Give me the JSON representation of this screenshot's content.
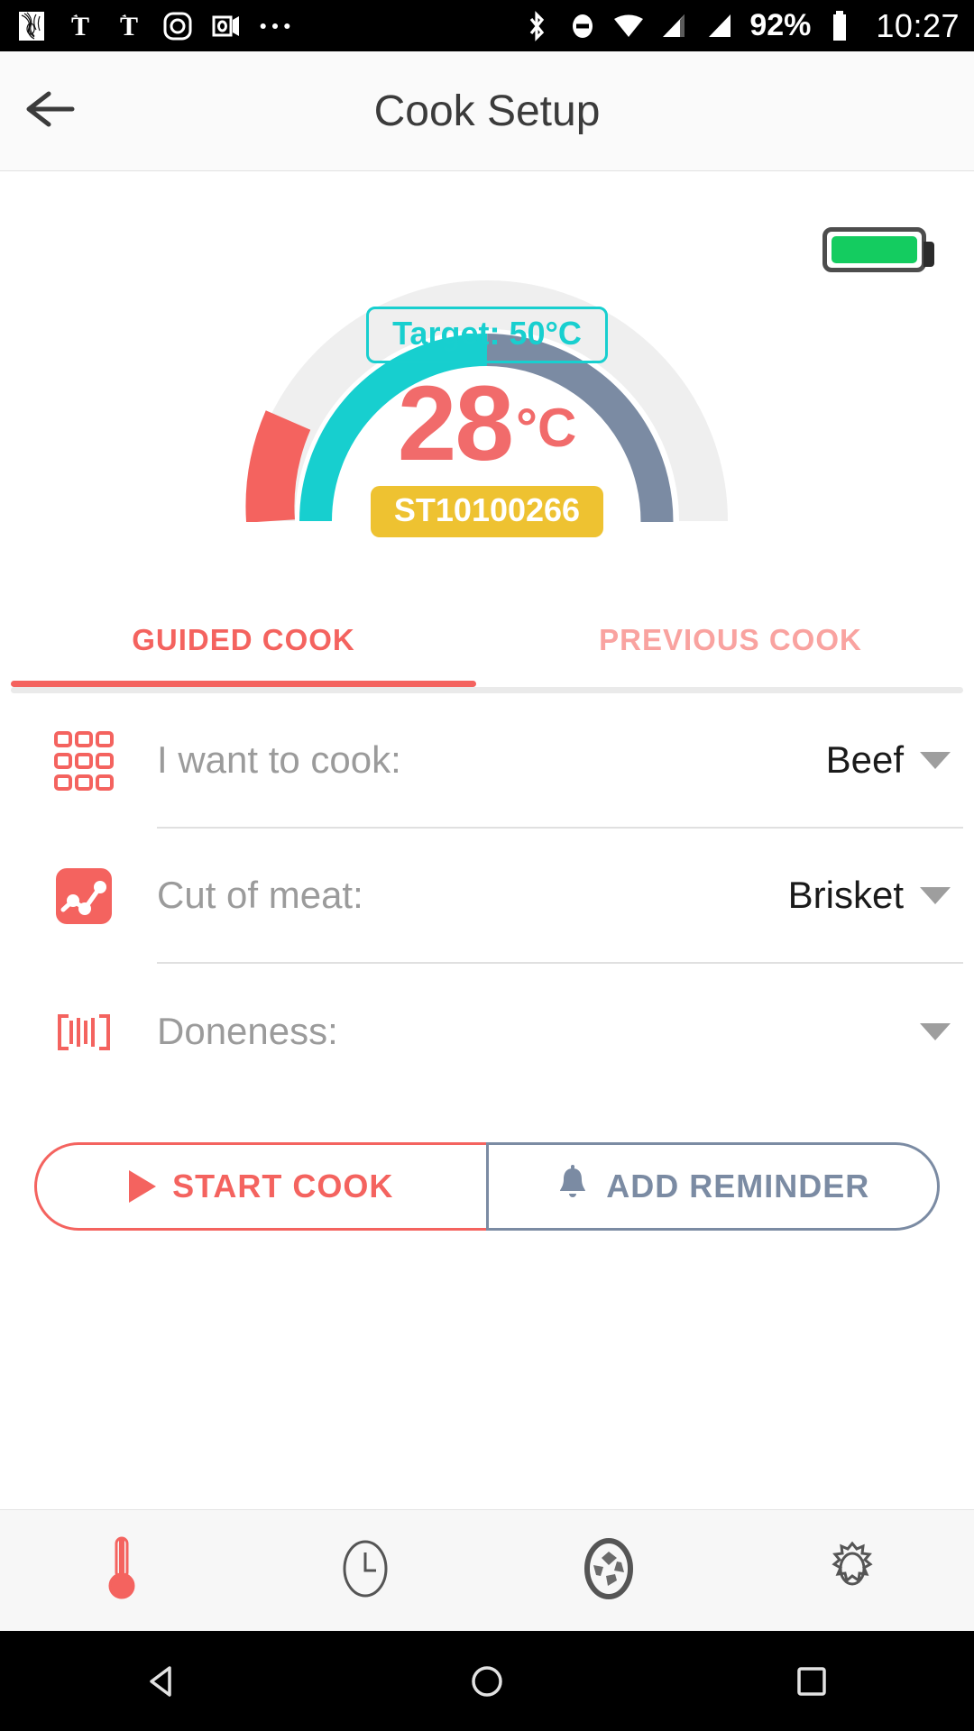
{
  "status_bar": {
    "icons": [
      "nyt-maps-icon",
      "nyt-icon",
      "nyt-icon-2",
      "instagram-icon",
      "outlook-icon",
      "more-dots-icon"
    ],
    "right_icons": [
      "bluetooth-icon",
      "do-not-disturb-icon",
      "wifi-icon",
      "signal-sim1-icon",
      "signal-sim2-icon"
    ],
    "battery_percent": "92%",
    "time": "10:27"
  },
  "appbar": {
    "back_icon": "arrow-left-icon",
    "title": "Cook Setup"
  },
  "gauge": {
    "target_label": "Target: 50°C",
    "temperature_value": "28",
    "temperature_unit": "°C",
    "probe_id": "ST10100266",
    "battery_icon": "battery-full-icon",
    "colors": {
      "track": "#efefef",
      "range_red": "#f4635f",
      "progress_teal": "#17cfcf",
      "target_blue": "#7b8ba3",
      "temp_text": "#f16b6b",
      "target_text": "#18cfcf",
      "badge": "#eec231",
      "battery_fill": "#14cc60"
    }
  },
  "tabs": [
    {
      "label": "GUIDED COOK",
      "active": true
    },
    {
      "label": "PREVIOUS COOK",
      "active": false
    }
  ],
  "form_rows": [
    {
      "icon": "grid-squares-icon",
      "label": "I want to cook:",
      "value": "Beef"
    },
    {
      "icon": "line-chart-icon",
      "label": "Cut of meat:",
      "value": "Brisket"
    },
    {
      "icon": "barcode-icon",
      "label": "Doneness:",
      "value": ""
    }
  ],
  "actions": {
    "start_label": "START COOK",
    "start_icon": "play-icon",
    "reminder_label": "ADD REMINDER",
    "reminder_icon": "bell-icon"
  },
  "bottom_nav": [
    {
      "icon": "thermometer-icon",
      "active": true
    },
    {
      "icon": "clock-icon",
      "active": false
    },
    {
      "icon": "aperture-icon",
      "active": false
    },
    {
      "icon": "gear-icon",
      "active": false
    }
  ],
  "android_nav": [
    {
      "icon": "nav-back-icon"
    },
    {
      "icon": "nav-home-icon"
    },
    {
      "icon": "nav-recents-icon"
    }
  ]
}
